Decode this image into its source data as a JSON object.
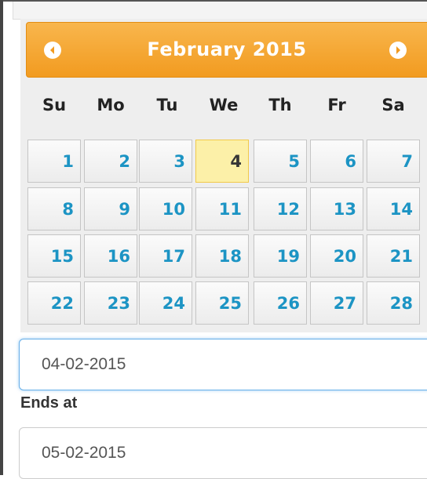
{
  "calendar": {
    "month_title": "February 2015",
    "prev_icon": "chevron-left-circle-icon",
    "next_icon": "chevron-right-circle-icon",
    "days_of_week": [
      "Su",
      "Mo",
      "Tu",
      "We",
      "Th",
      "Fr",
      "Sa"
    ],
    "weeks": [
      [
        "1",
        "2",
        "3",
        "4",
        "5",
        "6",
        "7"
      ],
      [
        "8",
        "9",
        "10",
        "11",
        "12",
        "13",
        "14"
      ],
      [
        "15",
        "16",
        "17",
        "18",
        "19",
        "20",
        "21"
      ],
      [
        "22",
        "23",
        "24",
        "25",
        "26",
        "27",
        "28"
      ]
    ],
    "today": "4",
    "colors": {
      "header": "#f29b20",
      "day_text": "#1c94c4",
      "today_bg": "#fcf0a8",
      "focus_border": "#66afe9"
    }
  },
  "form": {
    "start_value": "04-02-2015",
    "ends_label": "Ends at",
    "end_value": "05-02-2015"
  }
}
